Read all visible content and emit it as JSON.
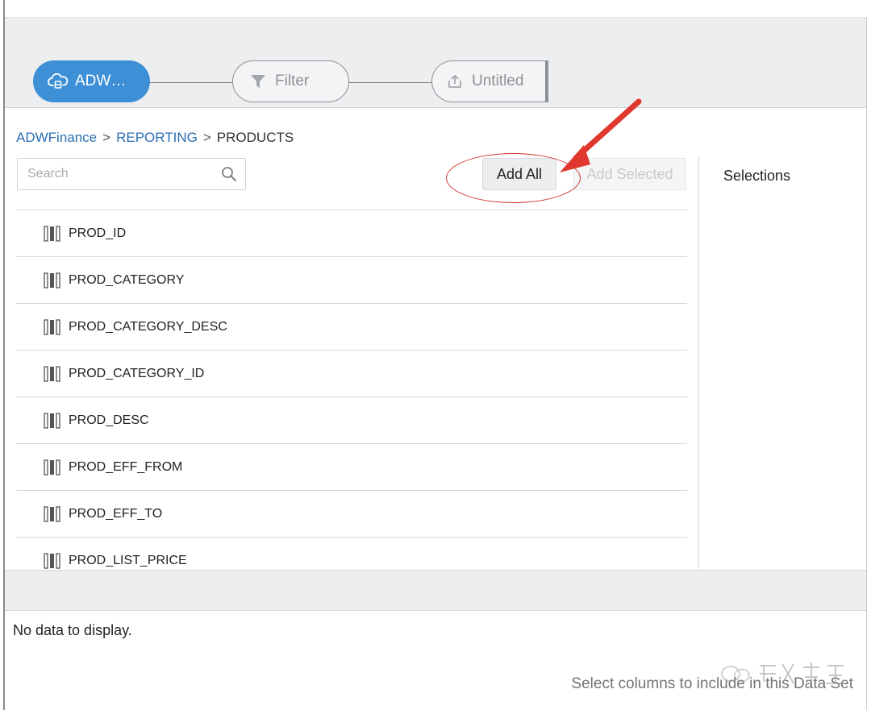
{
  "pipeline": {
    "source_label": "ADW…",
    "filter_label": "Filter",
    "output_label": "Untitled",
    "accent_color": "#3d8fd6"
  },
  "breadcrumb": {
    "items": [
      "ADWFinance",
      "REPORTING",
      "PRODUCTS"
    ],
    "separator": ">"
  },
  "search": {
    "placeholder": "Search",
    "value": ""
  },
  "toolbar": {
    "add_all_label": "Add All",
    "add_selected_label": "Add Selected"
  },
  "selections": {
    "title": "Selections"
  },
  "columns": [
    "PROD_ID",
    "PROD_CATEGORY",
    "PROD_CATEGORY_DESC",
    "PROD_CATEGORY_ID",
    "PROD_DESC",
    "PROD_EFF_FROM",
    "PROD_EFF_TO",
    "PROD_LIST_PRICE"
  ],
  "preview": {
    "empty_message": "No data to display.",
    "hint": "Select columns to include in this Data Set"
  },
  "icons": {
    "source": "cloud-database-icon",
    "filter": "funnel-icon",
    "output": "upload-icon",
    "search": "magnifier-icon",
    "column": "column-bars-icon"
  },
  "annotation_color": "#d0342c"
}
